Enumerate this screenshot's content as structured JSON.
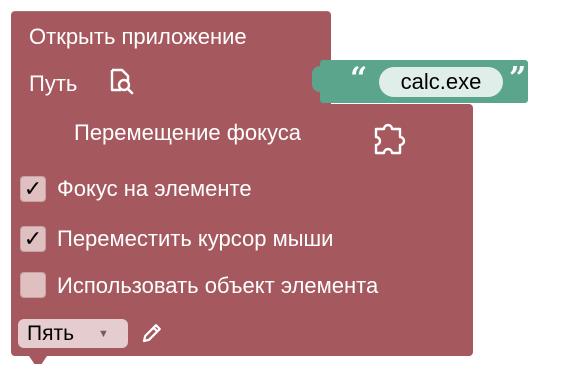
{
  "open_app_block": {
    "title": "Открыть приложение",
    "path_label": "Путь",
    "path_icon": "file-search-icon",
    "path_value": "calc.exe",
    "quote_open": "“",
    "quote_close": "”"
  },
  "focus_block": {
    "title": "Перемещение фокуса",
    "title_icon": "puzzle-icon",
    "options": [
      {
        "label": "Фокус на элементе",
        "checked": true
      },
      {
        "label": "Переместить курсор мыши",
        "checked": true
      },
      {
        "label": "Использовать объект элемента",
        "checked": false
      }
    ],
    "check_mark": "✓",
    "dropdown_value": "Пять",
    "dropdown_arrow": "▼",
    "edit_icon": "pencil-icon"
  },
  "colors": {
    "block": "#a5595f",
    "string_block": "#5ba58c",
    "field": "#dfeee9",
    "checkbox": "#e0bfc1"
  }
}
